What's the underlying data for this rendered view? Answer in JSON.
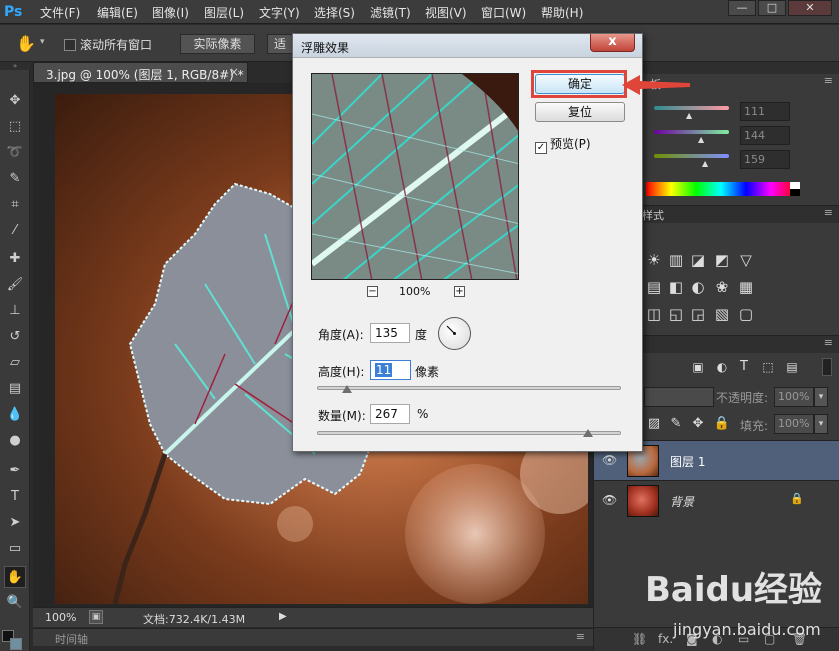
{
  "app": {
    "logo": "Ps"
  },
  "menu": [
    "文件(F)",
    "编辑(E)",
    "图像(I)",
    "图层(L)",
    "文字(Y)",
    "选择(S)",
    "滤镜(T)",
    "视图(V)",
    "窗口(W)",
    "帮助(H)"
  ],
  "window_controls": {
    "minimize": "—",
    "maximize": "□",
    "close": "✕"
  },
  "options_bar": {
    "scroll_all_label": "滚动所有窗口",
    "actual_pixels": "实际像素",
    "fit_screen": "适"
  },
  "document": {
    "tab_title": "3.jpg @ 100% (图层 1, RGB/8#) *",
    "tab_close": "×",
    "zoom": "100%",
    "doc_info": "文档:732.4K/1.43M",
    "timeline_label": "时间轴"
  },
  "dialog": {
    "title": "浮雕效果",
    "close_symbol": "x",
    "ok_label": "确定",
    "reset_label": "复位",
    "preview_label": "预览(P)",
    "preview_checked": true,
    "zoom_minus": "−",
    "zoom_plus": "+",
    "preview_zoom": "100%",
    "angle_label": "角度(A):",
    "angle_value": "135",
    "angle_unit": "度",
    "height_label": "高度(H):",
    "height_value": "11",
    "height_unit": "像素",
    "amount_label": "数量(M):",
    "amount_value": "267",
    "amount_unit": "%",
    "height_slider_fraction": 0.1,
    "amount_slider_fraction": 0.89
  },
  "color_panel": {
    "r": "111",
    "g": "144",
    "b": "159",
    "tab_fragment": "板"
  },
  "styles_panel": {
    "tab_fragment": "样式"
  },
  "layers_panel": {
    "opacity_label": "不透明度:",
    "opacity_value": "100%",
    "fill_label": "填充:",
    "fill_value": "100%",
    "layers": [
      {
        "name": "图层 1",
        "selected": true
      },
      {
        "name": "背景",
        "selected": false,
        "locked": true
      }
    ],
    "footer_fx": "fx."
  },
  "watermark": {
    "brand": "Baidu经验",
    "url": "jingyan.baidu.com"
  },
  "colors": {
    "accent_red": "#e0453a",
    "ps_blue": "#31a8ff",
    "selection": "#3c7fd6"
  }
}
